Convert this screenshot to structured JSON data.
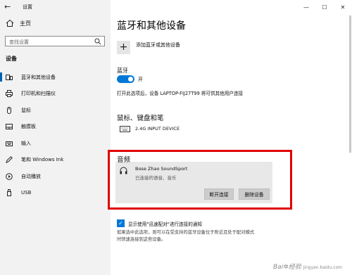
{
  "window": {
    "title": "设置",
    "controls": [
      "—",
      "☐",
      "✕"
    ]
  },
  "sidebar": {
    "home_label": "主页",
    "search_placeholder": "查找设置",
    "section_label": "设备",
    "items": [
      {
        "label": "蓝牙和其他设备",
        "icon": "bluetooth-devices-icon",
        "active": true
      },
      {
        "label": "打印机和扫描仪",
        "icon": "printer-icon",
        "active": false
      },
      {
        "label": "鼠标",
        "icon": "mouse-icon",
        "active": false
      },
      {
        "label": "触摸板",
        "icon": "touchpad-icon",
        "active": false
      },
      {
        "label": "输入",
        "icon": "keyboard-icon",
        "active": false
      },
      {
        "label": "笔和 Windows Ink",
        "icon": "pen-icon",
        "active": false
      },
      {
        "label": "自动播放",
        "icon": "autoplay-icon",
        "active": false
      },
      {
        "label": "USB",
        "icon": "usb-icon",
        "active": false
      }
    ]
  },
  "main": {
    "title": "蓝牙和其他设备",
    "add_device_label": "添加蓝牙或其他设备",
    "bluetooth": {
      "heading": "蓝牙",
      "toggle_state": "开",
      "discoverable_text": "打开此选项后，设备 LAPTOP-FIJ27T99 将可供其他用户连接"
    },
    "mouse_keyboard": {
      "heading": "鼠标、键盘和笔",
      "device_name": "2.4G INPUT DEVICE"
    },
    "audio": {
      "heading": "音频",
      "device_name": "Bose Zhao SoundSport",
      "device_status": "已连接的语音、音乐",
      "disconnect_label": "断开连接",
      "remove_label": "删除设备"
    },
    "swift_pair": {
      "label": "显示使用\"迅速配对\"进行连接的通知",
      "checked": true,
      "description": "如果选中此选项，则可以在受支持的蓝牙设备位于附近且处于配对模式时快速连接到这些设备。"
    }
  },
  "colors": {
    "accent": "#0078d7",
    "highlight": "#e00000"
  }
}
